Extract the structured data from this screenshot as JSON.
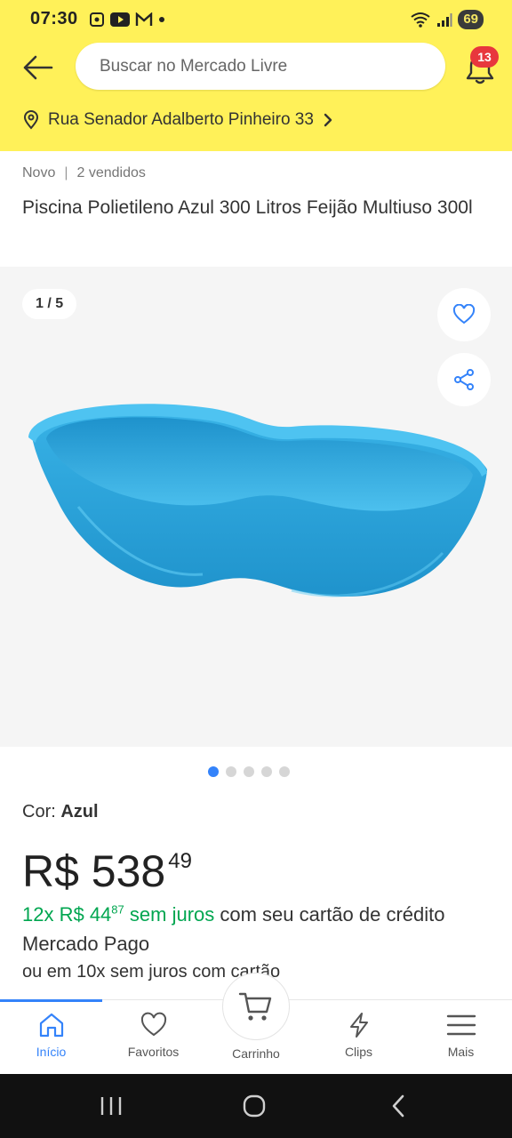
{
  "status_bar": {
    "time": "07:30",
    "battery": "69",
    "left_icons": [
      "screenshot-icon",
      "youtube-icon",
      "gmail-icon",
      "dot-icon"
    ],
    "right_icons": [
      "wifi-icon",
      "signal-icon",
      "battery-icon"
    ]
  },
  "header": {
    "search_placeholder": "Buscar no Mercado Livre",
    "notifications_count": "13",
    "address": "Rua Senador Adalberto Pinheiro 33",
    "background_color": "#fff159"
  },
  "product": {
    "condition": "Novo",
    "sold": "2 vendidos",
    "title": "Piscina Polietileno Azul 300 Litros Feijão Multiuso 300l",
    "gallery_counter": "1 / 5",
    "gallery_total": 5,
    "gallery_active": 1,
    "color_label": "Cor:",
    "color_value": "Azul",
    "price_main": "R$ 538",
    "price_cents": "49",
    "installment_prefix": "12x R$ 44",
    "installment_cents": "87",
    "installment_no_interest": "sem juros",
    "installment_suffix": "com seu cartão de crédito Mercado Pago",
    "more_installments": "ou em 10x sem juros com cartão"
  },
  "bottom_nav": {
    "items": [
      {
        "label": "Início",
        "icon": "home-icon",
        "active": true
      },
      {
        "label": "Favoritos",
        "icon": "heart-icon",
        "active": false
      },
      {
        "label": "Carrinho",
        "icon": "cart-icon",
        "active": false
      },
      {
        "label": "Clips",
        "icon": "lightning-icon",
        "active": false
      },
      {
        "label": "Mais",
        "icon": "menu-icon",
        "active": false
      }
    ]
  },
  "colors": {
    "accent_blue": "#3483fa",
    "green": "#00a650",
    "badge_red": "#e8373d",
    "pool_blue": "#2aa8dc"
  }
}
